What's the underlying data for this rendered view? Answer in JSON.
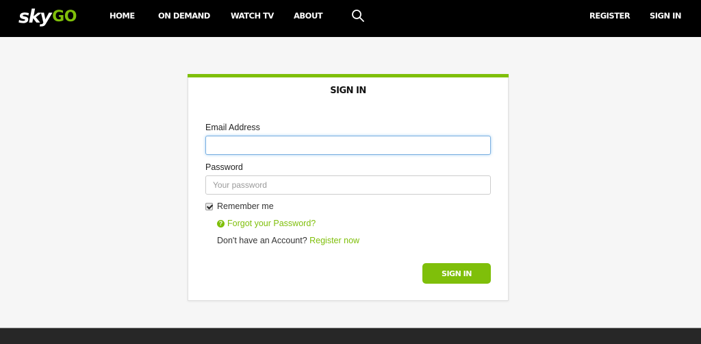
{
  "header": {
    "logo": {
      "sky": "sky",
      "go": "GO"
    },
    "nav": [
      {
        "label": "HOME"
      },
      {
        "label": "ON DEMAND"
      },
      {
        "label": "WATCH TV"
      },
      {
        "label": "ABOUT"
      }
    ],
    "search_icon": "search-icon",
    "register_label": "REGISTER",
    "signin_label": "SIGN IN"
  },
  "form": {
    "title": "SIGN IN",
    "email": {
      "label": "Email Address",
      "value": "",
      "placeholder": ""
    },
    "password": {
      "label": "Password",
      "value": "",
      "placeholder": "Your password"
    },
    "remember": {
      "label": "Remember me",
      "checked": true
    },
    "forgot": {
      "icon": "question-circle-icon",
      "label": "Forgot your Password?"
    },
    "no_account": {
      "text": "Don't have an Account?",
      "link": "Register now"
    },
    "submit_label": "SIGN IN"
  },
  "colors": {
    "accent": "#7fbf0a",
    "header_bg": "#000000",
    "page_bg": "#f6f6f6",
    "footer_bg": "#272727"
  }
}
